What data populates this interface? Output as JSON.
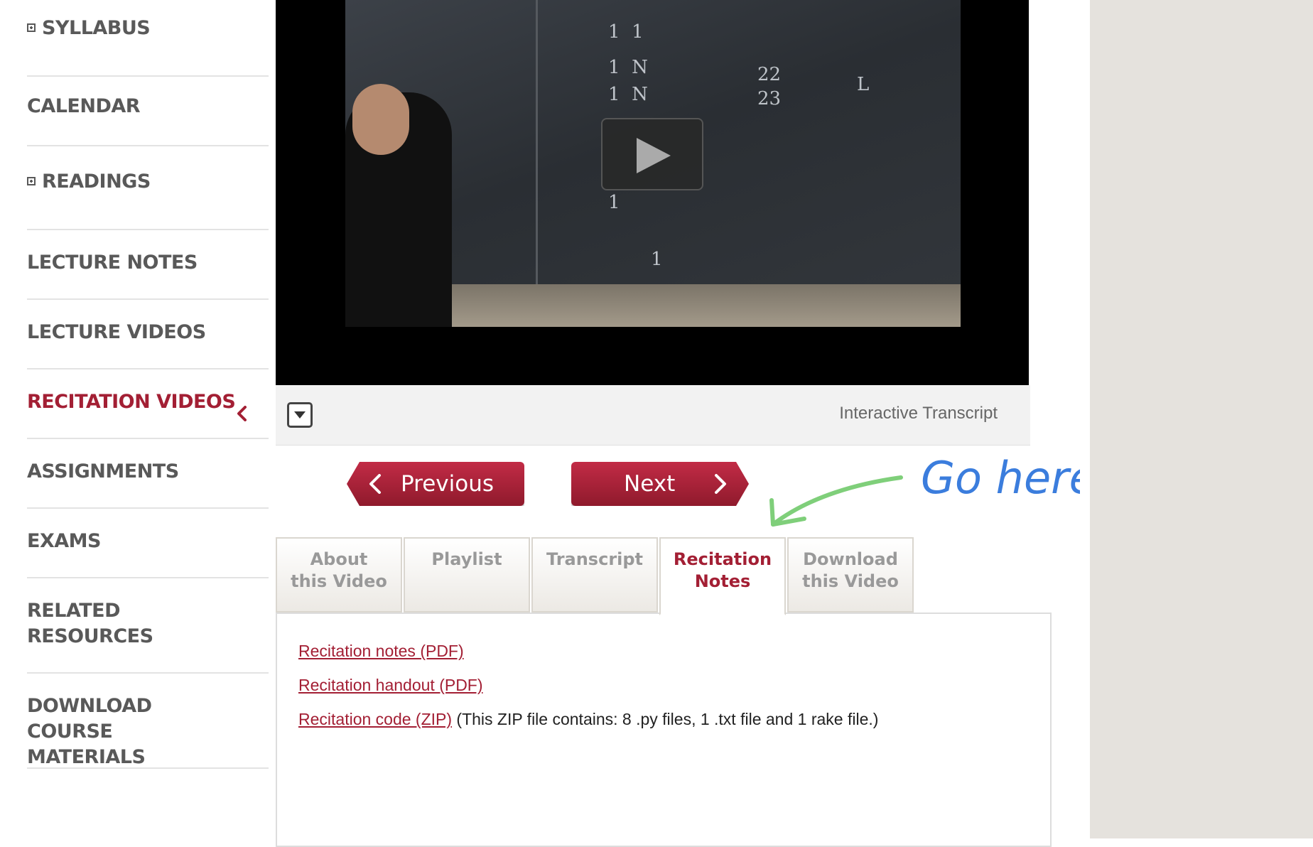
{
  "sidebar": {
    "items": [
      {
        "label": "SYLLABUS",
        "expandable": true,
        "active": false
      },
      {
        "label": "CALENDAR",
        "expandable": false,
        "active": false
      },
      {
        "label": "READINGS",
        "expandable": true,
        "active": false
      },
      {
        "label": "LECTURE NOTES",
        "expandable": false,
        "active": false
      },
      {
        "label": "LECTURE VIDEOS",
        "expandable": false,
        "active": false
      },
      {
        "label": "RECITATION VIDEOS",
        "expandable": false,
        "active": true
      },
      {
        "label": "ASSIGNMENTS",
        "expandable": false,
        "active": false
      },
      {
        "label": "EXAMS",
        "expandable": false,
        "active": false
      },
      {
        "label": "RELATED RESOURCES",
        "expandable": false,
        "active": false
      },
      {
        "label": "DOWNLOAD COURSE MATERIALS",
        "expandable": false,
        "active": false
      }
    ]
  },
  "video": {
    "transcript_label": "Interactive Transcript"
  },
  "pager": {
    "previous_label": "Previous",
    "next_label": "Next"
  },
  "annotation": {
    "text": "Go here"
  },
  "tabs": [
    {
      "line1": "About",
      "line2": "this Video",
      "active": false
    },
    {
      "line1": "Playlist",
      "line2": "",
      "active": false
    },
    {
      "line1": "Transcript",
      "line2": "",
      "active": false
    },
    {
      "line1": "Recitation",
      "line2": "Notes",
      "active": true
    },
    {
      "line1": "Download",
      "line2": "this Video",
      "active": false
    }
  ],
  "recitation_notes": {
    "links": [
      {
        "label": "Recitation notes (PDF)",
        "note": ""
      },
      {
        "label": "Recitation handout (PDF)",
        "note": ""
      },
      {
        "label": "Recitation code (ZIP)",
        "note": " (This ZIP file contains: 8 .py files, 1 .txt file and 1 rake file.)"
      }
    ]
  },
  "colors": {
    "accent": "#a31f34",
    "nav_text": "#595959",
    "annotation_text": "#3b7ddd",
    "annotation_arrow": "#7fcf7a"
  }
}
